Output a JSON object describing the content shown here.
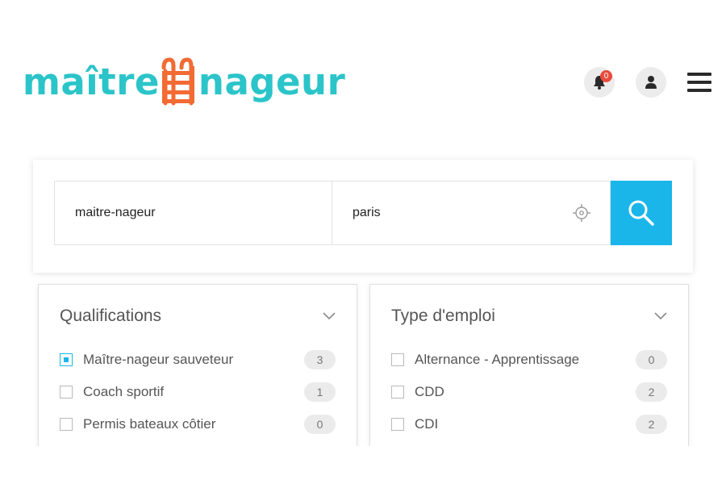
{
  "header": {
    "logo_part1": "maître",
    "logo_part2": "nageur",
    "logo_color": "#2bc4c9",
    "ladder_color": "#f26b34",
    "notifications": {
      "icon": "bell-icon",
      "count": "0",
      "badge_color": "#e94b3c"
    },
    "account_icon": "user-icon",
    "menu_icon": "hamburger-menu-icon"
  },
  "search": {
    "what_value": "maitre-nageur",
    "where_value": "paris",
    "locate_icon": "crosshair-icon",
    "button_icon": "search-icon",
    "button_color": "#1ab6ea"
  },
  "filters": {
    "qualifications": {
      "title": "Qualifications",
      "options": [
        {
          "label": "Maître-nageur sauveteur",
          "count": "3",
          "checked": true
        },
        {
          "label": "Coach sportif",
          "count": "1",
          "checked": false
        },
        {
          "label": "Permis bateaux côtier",
          "count": "0",
          "checked": false
        }
      ]
    },
    "job_type": {
      "title": "Type d'emploi",
      "options": [
        {
          "label": "Alternance - Apprentissage",
          "count": "0",
          "checked": false
        },
        {
          "label": "CDD",
          "count": "2",
          "checked": false
        },
        {
          "label": "CDI",
          "count": "2",
          "checked": false
        }
      ]
    }
  }
}
